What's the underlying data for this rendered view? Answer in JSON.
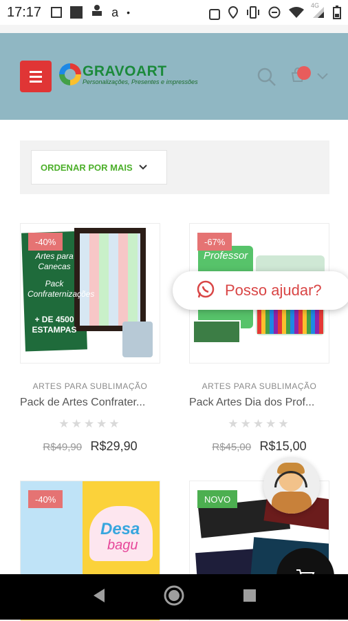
{
  "status_bar": {
    "time": "17:17",
    "network": "4G",
    "left_icons": [
      "news-icon",
      "square-icon",
      "person-icon",
      "amazon-icon",
      "dot-icon"
    ],
    "right_icons": [
      "nfc-icon",
      "location-icon",
      "vibrate-icon",
      "dnd-icon",
      "wifi-icon",
      "signal-icon",
      "battery-icon"
    ]
  },
  "header": {
    "logo_title": "GRAVOART",
    "logo_subtitle": "Personalizações, Presentes e impressões",
    "cart_count": "",
    "bg_color": "#90b7c3",
    "menu_color": "#e03535"
  },
  "sort": {
    "label": "ORDENAR POR MAIS"
  },
  "products": [
    {
      "badge": "-40%",
      "badge_type": "sale",
      "category": "ARTES PARA SUBLIMAÇÃO",
      "title": "Pack de Artes Confrater...",
      "old_price": "R$49,90",
      "price": "R$29,90",
      "art_text": "Artes para Canecas",
      "art_text2": "Pack Confraternizações",
      "art_text3": "+ DE 4500 ESTAMPAS"
    },
    {
      "badge": "-67%",
      "badge_type": "sale",
      "category": "ARTES PARA SUBLIMAÇÃO",
      "title": "Pack Artes Dia dos Prof...",
      "old_price": "R$45,00",
      "price": "R$15,00",
      "art_text": "Professor"
    },
    {
      "badge": "-40%",
      "badge_type": "sale",
      "art_text": "Desa",
      "art_text2": "bagu"
    },
    {
      "badge": "NOVO",
      "badge_type": "new"
    }
  ],
  "whatsapp": {
    "label": "Posso ajudar?"
  },
  "nav": {
    "buttons": [
      "back",
      "home",
      "recents"
    ]
  }
}
